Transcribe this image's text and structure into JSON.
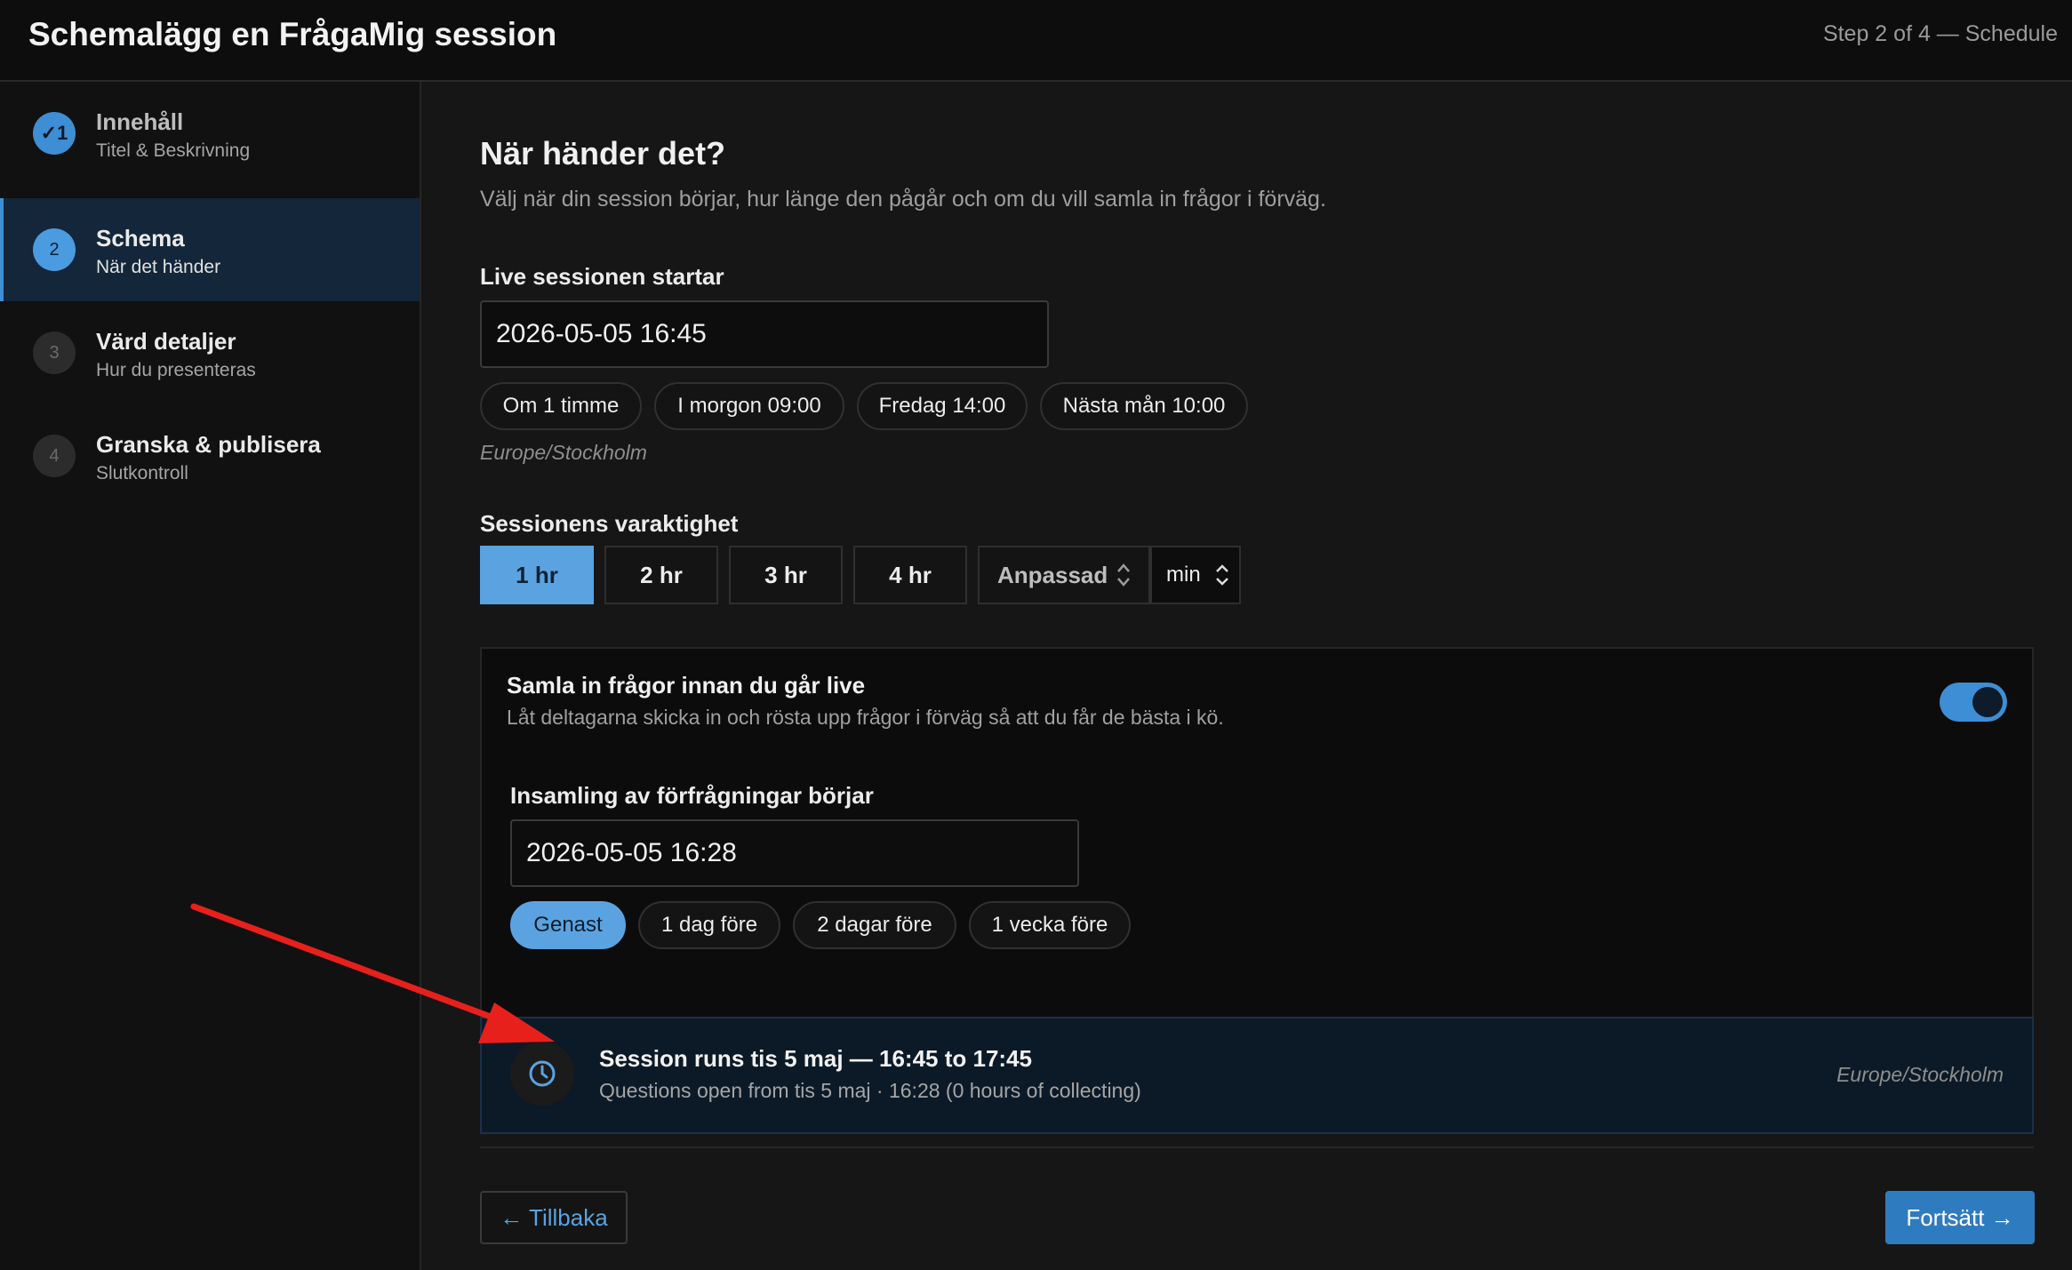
{
  "header": {
    "title": "Schemalägg en FrågaMig session",
    "step": "Step 2 of 4 — Schedule"
  },
  "sidebar": {
    "items": [
      {
        "num": "✓1",
        "label": "Innehåll",
        "sub": "Titel & Beskrivning",
        "state": "done"
      },
      {
        "num": "2",
        "label": "Schema",
        "sub": "När det händer",
        "state": "current"
      },
      {
        "num": "3",
        "label": "Värd detaljer",
        "sub": "Hur du presenteras",
        "state": "pending"
      },
      {
        "num": "4",
        "label": "Granska & publisera",
        "sub": "Slutkontroll",
        "state": "pending"
      }
    ]
  },
  "main": {
    "heading": "När händer det?",
    "lead": "Välj när din session börjar, hur länge den pågår och om du vill samla in frågor i förväg.",
    "start": {
      "label": "Live sessionen startar",
      "value": "2026-05-05 16:45",
      "presets": [
        "Om 1 timme",
        "I morgon 09:00",
        "Fredag 14:00",
        "Nästa mån 10:00"
      ],
      "timezone": "Europe/Stockholm"
    },
    "duration": {
      "label": "Sessionens varaktighet",
      "options": [
        "1 hr",
        "2 hr",
        "3 hr",
        "4 hr"
      ],
      "selected": "1 hr",
      "custom_label": "Anpassad",
      "unit": "min"
    },
    "collect": {
      "title": "Samla in frågor innan du går live",
      "desc": "Låt deltagarna skicka in och rösta upp frågor i förväg så att du får de bästa i kö.",
      "enabled": true,
      "start_label": "Insamling av förfrågningar börjar",
      "start_value": "2026-05-05 16:28",
      "presets": [
        "Genast",
        "1 dag före",
        "2 dagar före",
        "1 vecka före"
      ],
      "selected": "Genast"
    },
    "summary": {
      "title": "Session runs tis 5 maj — 16:45 to 17:45",
      "sub": "Questions open from tis 5 maj · 16:28 (0 hours of collecting)",
      "timezone": "Europe/Stockholm"
    },
    "back_label": "← Tillbaka",
    "next_label": "Fortsätt →"
  },
  "colors": {
    "accent": "#5aa3e0",
    "primary_button": "#2f7bbf",
    "annotation_arrow": "#e8201c"
  }
}
